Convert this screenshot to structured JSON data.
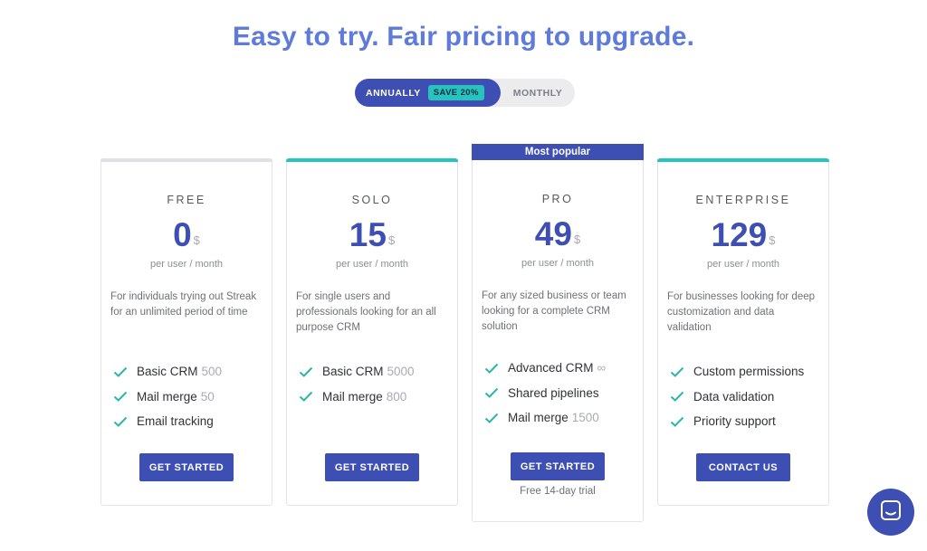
{
  "headline": "Easy to try. Fair pricing to upgrade.",
  "billing_toggle": {
    "annually_label": "ANNUALLY",
    "save_badge": "SAVE 20%",
    "monthly_label": "MONTHLY"
  },
  "plans": [
    {
      "tier": "FREE",
      "price": "0",
      "currency": "$",
      "per": "per user / month",
      "description": "For individuals trying out Streak for an unlimited period of time",
      "features": [
        {
          "label": "Basic CRM",
          "qty": "500"
        },
        {
          "label": "Mail merge",
          "qty": "50"
        },
        {
          "label": "Email tracking",
          "qty": ""
        }
      ],
      "button": "GET STARTED"
    },
    {
      "tier": "SOLO",
      "price": "15",
      "currency": "$",
      "per": "per user / month",
      "description": "For single users and professionals looking for an all purpose CRM",
      "features": [
        {
          "label": "Basic CRM",
          "qty": "5000"
        },
        {
          "label": "Mail merge",
          "qty": "800"
        }
      ],
      "button": "GET STARTED"
    },
    {
      "banner": "Most popular",
      "tier": "PRO",
      "price": "49",
      "currency": "$",
      "per": "per user / month",
      "description": "For any sized business or team looking for a complete CRM solution",
      "features": [
        {
          "label": "Advanced CRM",
          "qty": "∞"
        },
        {
          "label": "Shared pipelines",
          "qty": ""
        },
        {
          "label": "Mail merge",
          "qty": "1500"
        }
      ],
      "button": "GET STARTED",
      "note": "Free 14-day trial"
    },
    {
      "tier": "ENTERPRISE",
      "price": "129",
      "currency": "$",
      "per": "per user / month",
      "description": "For businesses looking for deep customization and data validation",
      "features": [
        {
          "label": "Custom permissions",
          "qty": ""
        },
        {
          "label": "Data validation",
          "qty": ""
        },
        {
          "label": "Priority support",
          "qty": ""
        }
      ],
      "button": "CONTACT US"
    }
  ],
  "colors": {
    "primary": "#3e4fb4",
    "headline": "#5f7bd9",
    "teal": "#27c4bd",
    "check": "#2bb7a8",
    "free_topbar": "#e0e1e5"
  },
  "icons": {
    "check": "check-icon",
    "chat": "chat-icon"
  }
}
